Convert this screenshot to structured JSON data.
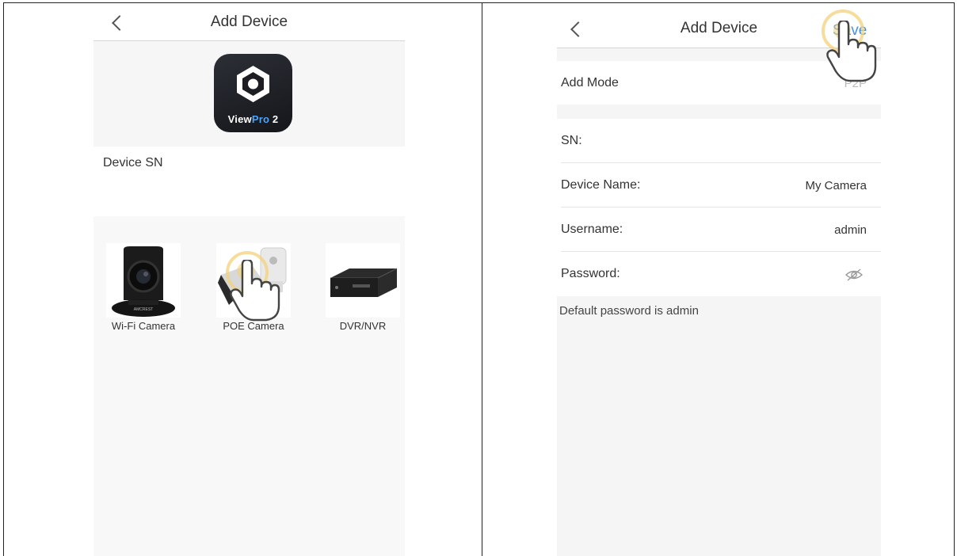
{
  "left_screen": {
    "title": "Add Device",
    "app_logo_text_a": "View",
    "app_logo_text_b": "Pro",
    "app_logo_text_c": "2",
    "device_sn_label": "Device SN",
    "device_types": [
      {
        "label": "Wi-Fi Camera",
        "icon": "wifi-camera-image"
      },
      {
        "label": "POE Camera",
        "icon": "poe-camera-image"
      },
      {
        "label": "DVR/NVR",
        "icon": "dvr-nvr-image"
      }
    ]
  },
  "right_screen": {
    "title": "Add Device",
    "save_label": "Save",
    "add_mode": {
      "label": "Add Mode",
      "value": "P2P"
    },
    "fields": [
      {
        "label": "SN:",
        "value": ""
      },
      {
        "label": "Device Name:",
        "value": "My Camera"
      },
      {
        "label": "Username:",
        "value": "admin"
      },
      {
        "label": "Password:",
        "value": ""
      }
    ],
    "hint": "Default password is admin"
  },
  "colors": {
    "accent": "#4a90e2",
    "tap_highlight": "#f3d27a",
    "background_grey": "#f6f6f6"
  }
}
